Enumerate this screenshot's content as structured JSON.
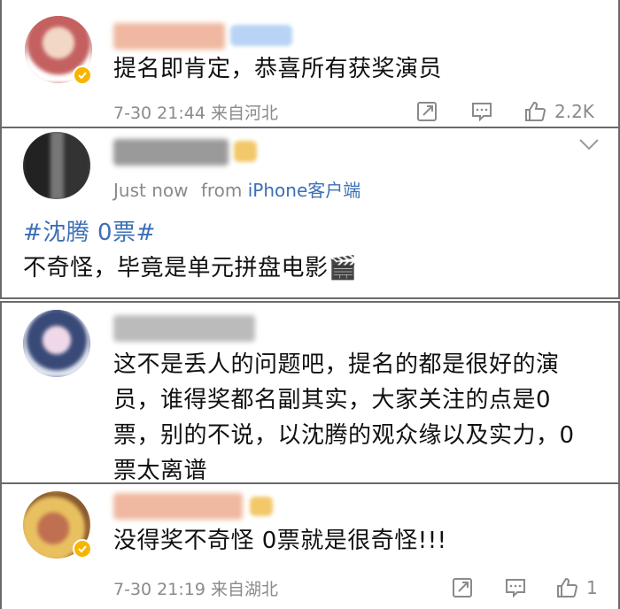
{
  "comments": [
    {
      "text": "提名即肯定，恭喜所有获奖演员",
      "time": "7-30 21:44",
      "location": "来自河北",
      "like_count": "2.2K",
      "colors": {
        "avatar": "#c46060",
        "name": "#e88a5a",
        "badge": "#8ab4e8"
      }
    },
    {
      "time_text": "Just now",
      "from_text": "from",
      "client_text": "iPhone客户端",
      "hashtag": "#沈腾 0票#",
      "text": "不奇怪，毕竟是单元拼盘电影",
      "emoji": "🎬",
      "colors": {
        "avatar": "#444444",
        "name": "#777777",
        "badge": "#f2c86a"
      }
    },
    {
      "text_lines": [
        "这不是丢人的问题吧，提名的都是很好的演",
        "员，谁得奖都名副其实，大家关注的点是0",
        "票，别的不说，以沈腾的观众缘以及实力，0",
        "票太离谱"
      ],
      "colors": {
        "avatar": "#3a4a78",
        "name": "#999999"
      }
    },
    {
      "text": "没得奖不奇怪 0票就是很奇怪!!!",
      "time": "7-30 21:19",
      "location": "来自湖北",
      "like_count": "1",
      "colors": {
        "avatar": "#d9a64a",
        "name": "#e88a5a",
        "badge": "#f2c86a"
      }
    }
  ],
  "icons": [
    "share-icon",
    "comment-icon",
    "like-icon",
    "chevron-down-icon",
    "verified-badge-icon"
  ]
}
